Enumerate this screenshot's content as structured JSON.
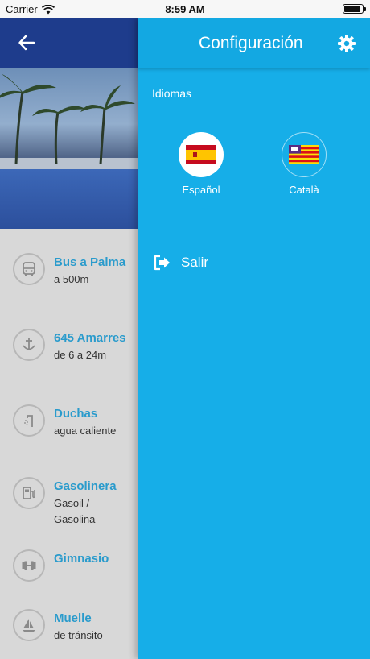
{
  "status_bar": {
    "carrier": "Carrier",
    "time": "8:59 AM"
  },
  "features": [
    {
      "icon": "bus-icon",
      "title": "Bus a Palma",
      "subtitle": "a 500m"
    },
    {
      "icon": "anchor-icon",
      "title": "645 Amarres",
      "subtitle": "de 6 a 24m"
    },
    {
      "icon": "shower-icon",
      "title": "Duchas",
      "subtitle": "agua caliente"
    },
    {
      "icon": "fuel-pump-icon",
      "title": "Gasolinera",
      "subtitle": "Gasoil / Gasolina"
    },
    {
      "icon": "dumbbell-icon",
      "title": "Gimnasio",
      "subtitle": ""
    },
    {
      "icon": "sailboat-icon",
      "title": "Muelle",
      "subtitle": "de tránsito"
    }
  ],
  "drawer": {
    "title": "Configuración",
    "languages_label": "Idiomas",
    "languages": [
      {
        "name": "Español",
        "selected": true
      },
      {
        "name": "Català",
        "selected": false
      }
    ],
    "logout_label": "Salir"
  },
  "colors": {
    "drawer_bg": "#16aee8",
    "header_bg": "#1e3c8c",
    "feature_title": "#2a9bcc"
  }
}
